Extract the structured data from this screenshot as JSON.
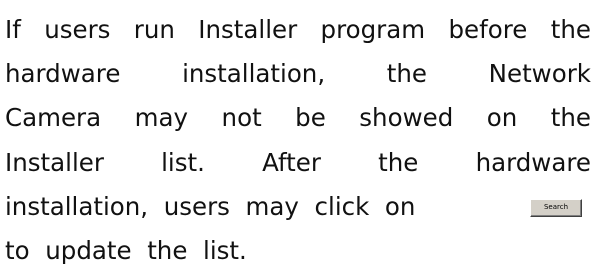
{
  "paragraph": {
    "lines": [
      [
        "If",
        "users",
        "run",
        "Installer",
        "program",
        "before",
        "the"
      ],
      [
        "hardware",
        "installation,",
        "the",
        "Network"
      ],
      [
        "Camera",
        "may",
        "not",
        "be",
        "showed",
        "on",
        "the"
      ],
      [
        "Installer",
        "list.",
        "After",
        "the",
        "hardware"
      ],
      [
        "installation,",
        "users",
        "may",
        "click",
        "on"
      ],
      [
        "to",
        "update",
        "the",
        "list."
      ]
    ]
  },
  "search_button": {
    "label": "Search"
  }
}
